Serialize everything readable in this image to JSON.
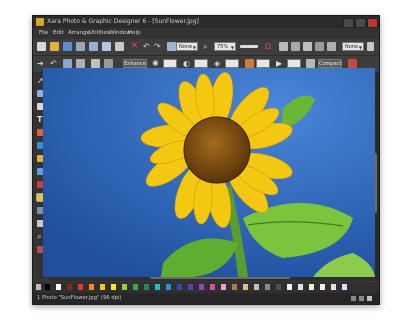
{
  "window": {
    "title": "Xara Photo & Graphic Designer 6 - [SunFlower.jpg]"
  },
  "menu": [
    "File",
    "Edit",
    "Arrange",
    "Utilities",
    "Window",
    "Help"
  ],
  "toolbar1": {
    "blend_mode": "None",
    "zoom": "75%",
    "right_mode": "None"
  },
  "toolbar2": {
    "enhance_label": "Enhance",
    "compact_label": "Compact"
  },
  "status": {
    "text": "1 Photo \"SunFlower.jpg\" (96 dpi)"
  },
  "colors": {
    "sky": "#2f63b6",
    "petal": "#f3c712",
    "disk": "#7a4b12",
    "leaf": "#6bb536",
    "chrome": "#3a3a3a"
  },
  "palette": [
    "#000000",
    "#ffffff",
    "#7a2b20",
    "#e63a2a",
    "#f28a1d",
    "#f6c51b",
    "#f5ea2a",
    "#9ccb3a",
    "#3ca843",
    "#1f8a5f",
    "#1ec0c8",
    "#2a8ee0",
    "#2a4ec0",
    "#5a3fb4",
    "#a13fb8",
    "#e04aa9",
    "#f3a0c0",
    "#b07a52",
    "#d9c08a",
    "#c0c0c0",
    "#8a8a8a",
    "#505050",
    "#f2f2f2",
    "#d8e8f8",
    "#e8f8d8",
    "#f8f0d0",
    "#f8d8d8",
    "#e8d8f8"
  ]
}
